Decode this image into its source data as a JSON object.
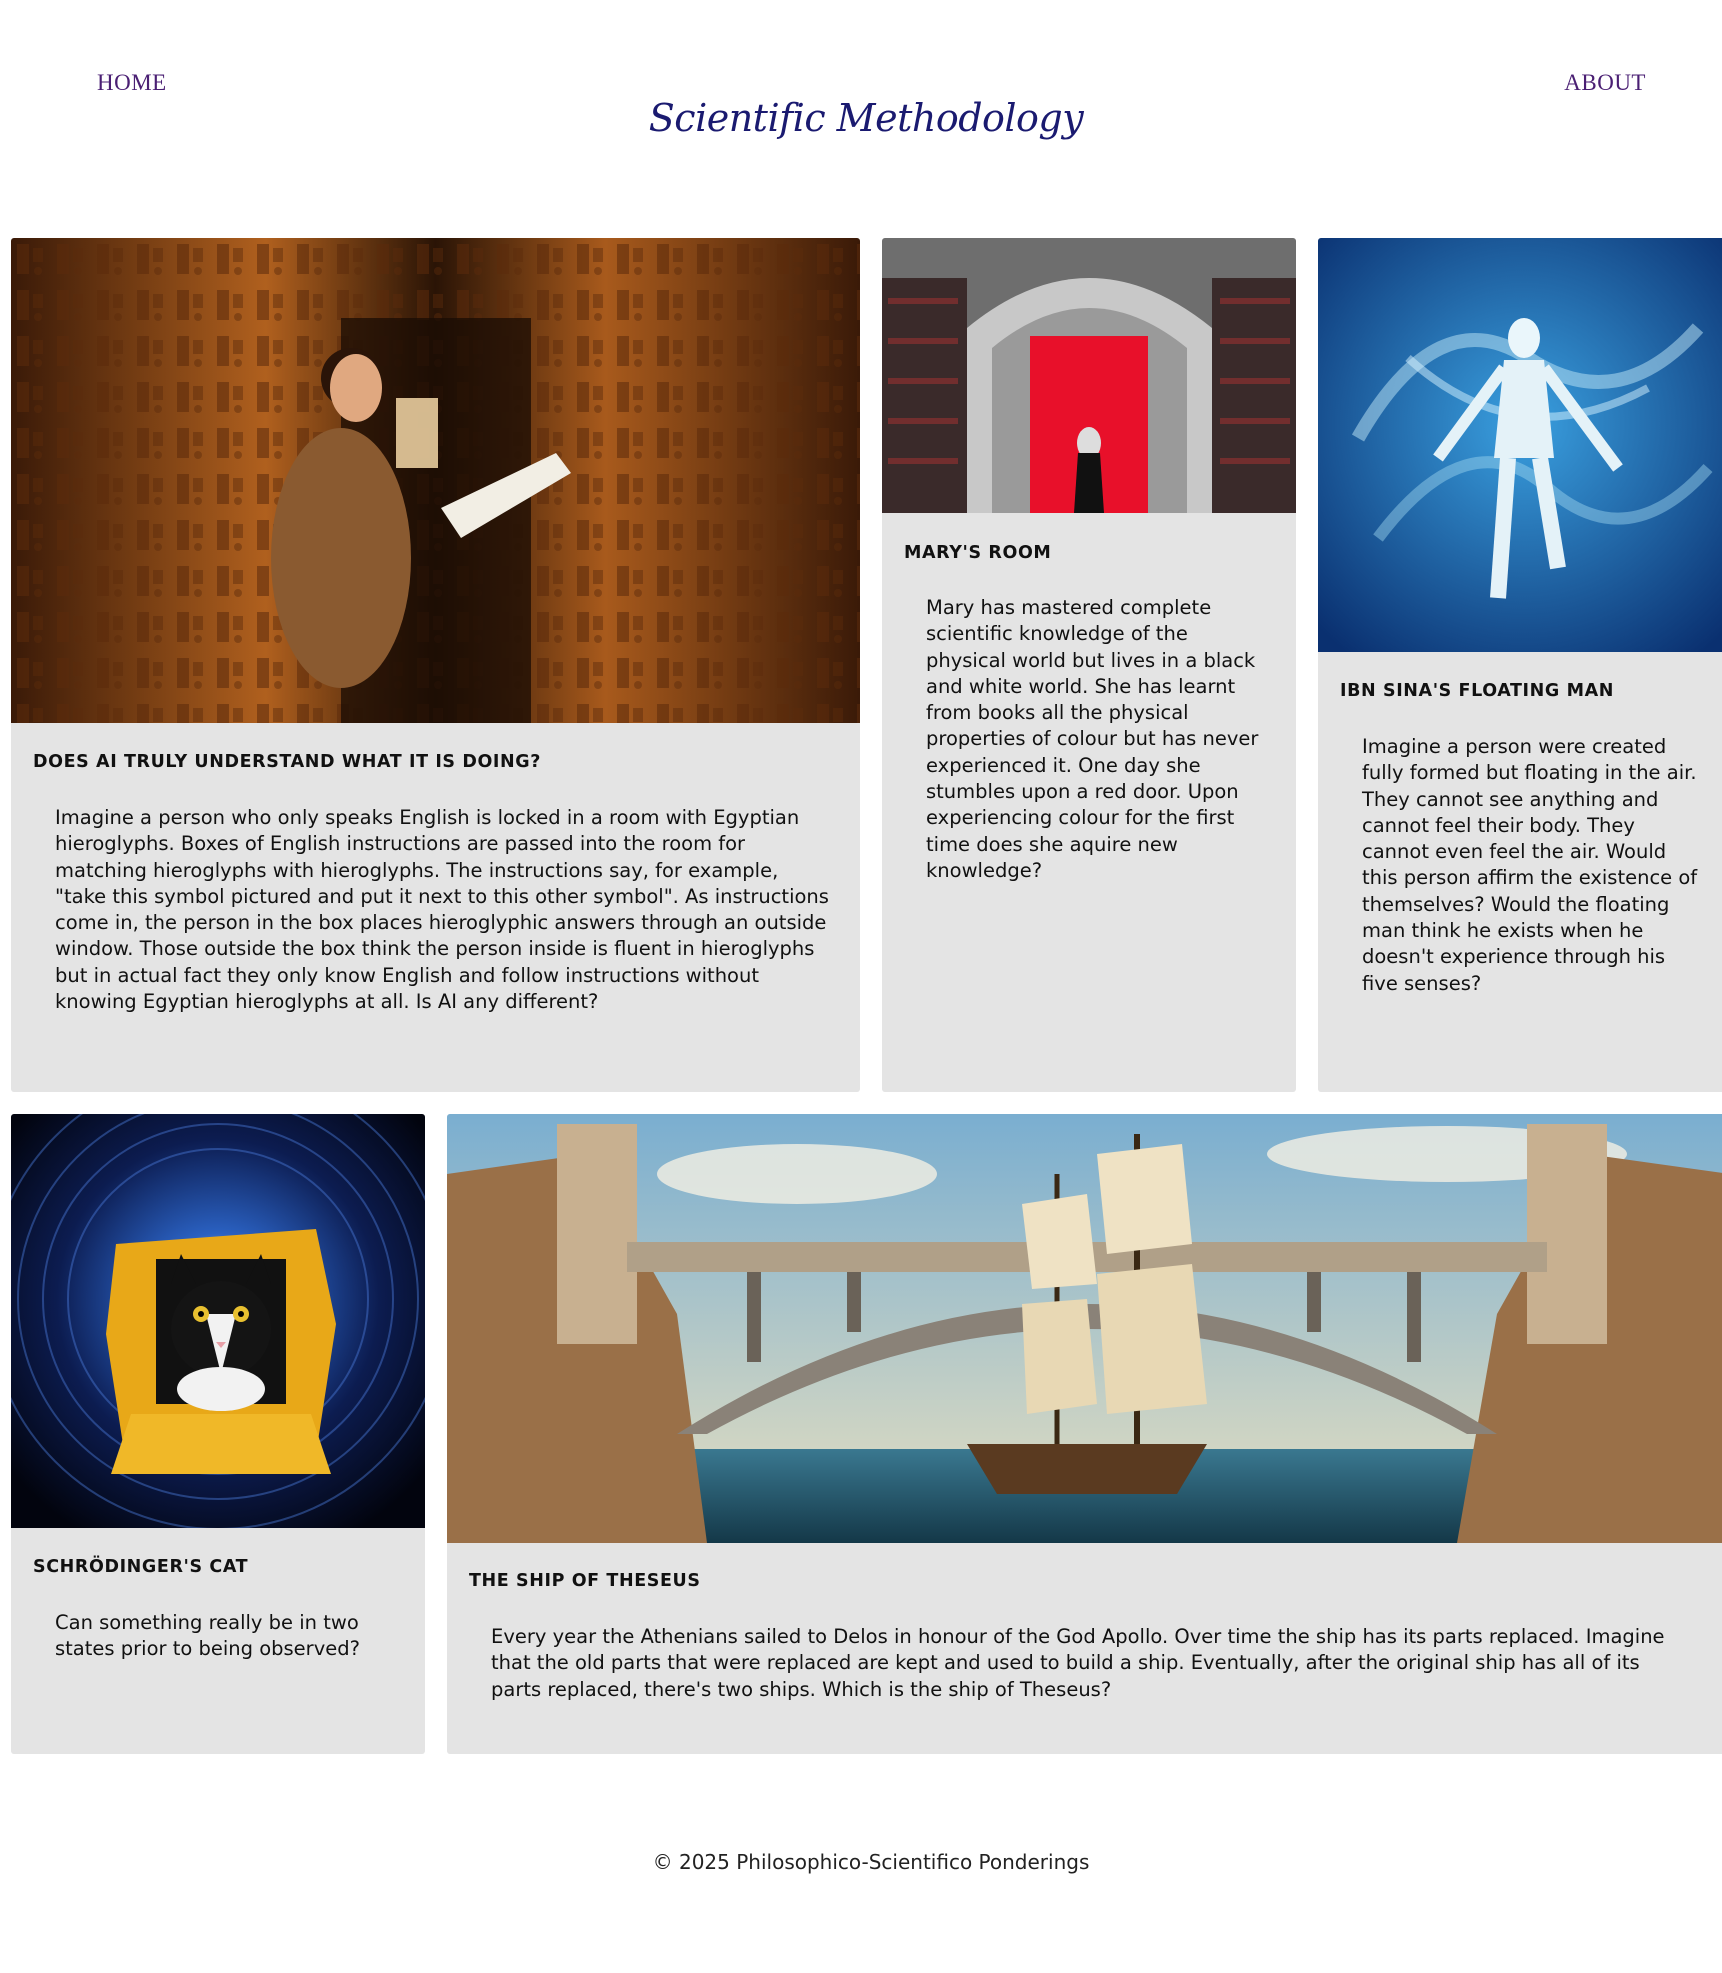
{
  "nav": {
    "home_label": "HOME",
    "about_label": "ABOUT"
  },
  "header": {
    "title": "Scientific Methodology"
  },
  "cards": [
    {
      "title": "DOES AI TRULY UNDERSTAND WHAT IT IS DOING?",
      "text": "Imagine a person who only speaks English is locked in a room with Egyptian hieroglyphs. Boxes of English instructions are passed into the room for matching hieroglyphs with hieroglyphs. The instructions say, for example, \"take this symbol pictured and put it next to this other symbol\". As instructions come in, the person in the box places hieroglyphic answers through an outside window. Those outside the box think the person inside is fluent in hieroglyphs but in actual fact they only know English and follow instructions without knowing Egyptian hieroglyphs at all. Is AI any different?",
      "image": "woman-reading-in-hieroglyph-corridor"
    },
    {
      "title": "MARY'S ROOM",
      "text": "Mary has mastered complete scientific knowledge of the physical world but lives in a black and white world. She has learnt from books all the physical properties of colour but has never experienced it. One day she stumbles upon a red door. Upon experiencing colour for the first time does she aquire new knowledge?",
      "image": "library-with-red-door"
    },
    {
      "title": "IBN SINA'S FLOATING MAN",
      "text": "Imagine a person were created fully formed but floating in the air. They cannot see anything and cannot feel their body. They cannot even feel the air. Would this person affirm the existence of themselves? Would the floating man think he exists when he doesn't experience through his five senses?",
      "image": "floating-man-in-blue"
    },
    {
      "title": "SCHRÖDINGER'S CAT",
      "text": "Can something really be in two states prior to being observed?",
      "image": "cat-in-box-tunnel"
    },
    {
      "title": "THE SHIP OF THESEUS",
      "text": "Every year the Athenians sailed to Delos in honour of the God Apollo. Over time the ship has its parts replaced. Imagine that the old parts that were replaced are kept and used to build a ship. Eventually, after the original ship has all of its parts replaced, there's two ships. Which is the ship of Theseus?",
      "image": "ship-under-bridge"
    }
  ],
  "footer": {
    "text": "© 2025 Philosophico-Scientifico Ponderings"
  },
  "colors": {
    "nav": "#4a1f73",
    "title": "#1a1a70",
    "card_bg": "#e4e4e4"
  }
}
